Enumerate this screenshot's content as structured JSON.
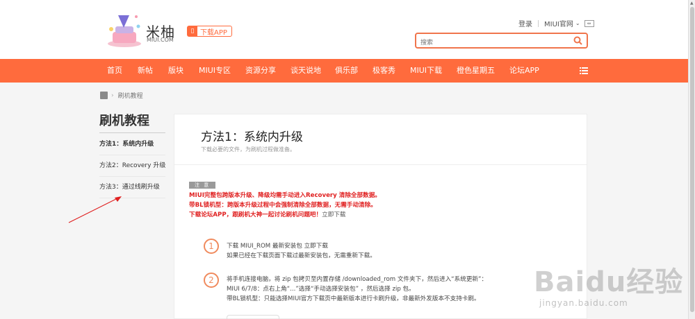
{
  "header": {
    "logo_text": "米柚",
    "logo_sub": "MIUI.COM",
    "app_button": "下载APP",
    "login": "登录",
    "miui_official": "MIUI官网",
    "search_placeholder": "搜索"
  },
  "nav": {
    "items": [
      "首页",
      "新帖",
      "版块",
      "MIUI专区",
      "资源分享",
      "谈天说地",
      "俱乐部",
      "极客秀",
      "MIUI下载",
      "橙色星期五",
      "论坛APP"
    ]
  },
  "breadcrumb": {
    "current": "刷机教程"
  },
  "sidebar": {
    "title": "刷机教程",
    "items": [
      {
        "label": "方法1：系统内升级"
      },
      {
        "label": "方法2：Recovery 升级"
      },
      {
        "label": "方法3：通过线刷升级"
      }
    ]
  },
  "content": {
    "title": "方法1：系统内升级",
    "subtitle": "下载必要的文件，为刷机过程做准备。",
    "note_tag": "注 意",
    "warnings": [
      "MIUI完整包跨版本升级、降级均需手动进入Recovery 清除全部数据。",
      "带BL锁机型：跨版本升级过程中会强制清除全部数据，无需手动清除。",
      "下载论坛APP，跟刷机大神一起讨论刷机问题吧！"
    ],
    "warning_link": "立即下载",
    "steps": [
      {
        "number": "1",
        "lines": [
          "下载 MIUI_ROM 最新安装包 立即下载",
          "如果已经在下载页面下载过最新安装包，无需重新下载。"
        ]
      },
      {
        "number": "2",
        "lines": [
          "将手机连接电脑，将 zip 包拷贝至内置存储 /downloaded_rom 文件夹下，然后进入“系统更新”：",
          "MIUI 6/7/8：点右上角“...”选择“手动选择安装包”  ，然后选择 zip 包。",
          "带BL锁机型：只能选择MIUI官方下载页中最新版本进行卡刷升级，非最新外发版本不支持卡刷。"
        ]
      }
    ]
  },
  "watermark": {
    "text": "Baidu经验",
    "url": "jingyan.baidu.com"
  },
  "colors": {
    "brand": "#ff6b3d",
    "warning": "#e02020"
  }
}
